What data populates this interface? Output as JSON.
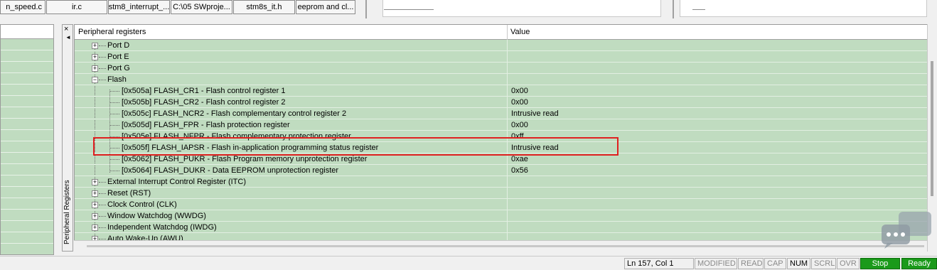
{
  "file_tabs": [
    "n_speed.c",
    "ir.c",
    "stm8_interrupt_...",
    "C:\\05 SWproje...",
    "stm8s_it.h",
    "eeprom and cl..."
  ],
  "dock": {
    "close_glyph": "×",
    "arrow_glyph": "◄",
    "vertical_label": "Peripheral Registers"
  },
  "table": {
    "col_name": "Peripheral registers",
    "col_value": "Value",
    "rows": [
      {
        "name": "Port D",
        "value": "",
        "expander": "+"
      },
      {
        "name": "Port E",
        "value": "",
        "expander": "+"
      },
      {
        "name": "Port G",
        "value": "",
        "expander": "+"
      },
      {
        "name": "Flash",
        "value": "",
        "expander": "−"
      },
      {
        "name": "[0x505a] FLASH_CR1 - Flash control register 1",
        "value": "0x00"
      },
      {
        "name": "[0x505b] FLASH_CR2 - Flash control register 2",
        "value": "0x00"
      },
      {
        "name": "[0x505c] FLASH_NCR2 - Flash complementary control register 2",
        "value": "Intrusive read"
      },
      {
        "name": "[0x505d] FLASH_FPR - Flash protection register",
        "value": "0x00"
      },
      {
        "name": "[0x505e] FLASH_NFPR - Flash complementary protection register",
        "value": "0xff"
      },
      {
        "name": "[0x505f] FLASH_IAPSR - Flash in-application programming status register",
        "value": "Intrusive read"
      },
      {
        "name": "[0x5062] FLASH_PUKR - Flash Program memory unprotection register",
        "value": "0xae"
      },
      {
        "name": "[0x5064] FLASH_DUKR - Data EEPROM unprotection register",
        "value": "0x56"
      },
      {
        "name": "External Interrupt Control Register (ITC)",
        "value": "",
        "expander": "+"
      },
      {
        "name": "Reset (RST)",
        "value": "",
        "expander": "+"
      },
      {
        "name": "Clock Control (CLK)",
        "value": "",
        "expander": "+"
      },
      {
        "name": "Window Watchdog (WWDG)",
        "value": "",
        "expander": "+"
      },
      {
        "name": "Independent Watchdog (IWDG)",
        "value": "",
        "expander": "+"
      },
      {
        "name": "Auto Wake-Up (AWU)",
        "value": "",
        "expander": "+"
      }
    ]
  },
  "status_bar": {
    "position": "Ln 157, Col 1",
    "modified": "MODIFIED",
    "read": "READ",
    "cap": "CAP",
    "num": "NUM",
    "scrl": "SCRL",
    "ovr": "OVR",
    "stop": "Stop",
    "ready": "Ready"
  },
  "colors": {
    "panel_bg": "#c0dcc0",
    "highlight_border": "#e02020",
    "status_green": "#1a9a1a"
  }
}
